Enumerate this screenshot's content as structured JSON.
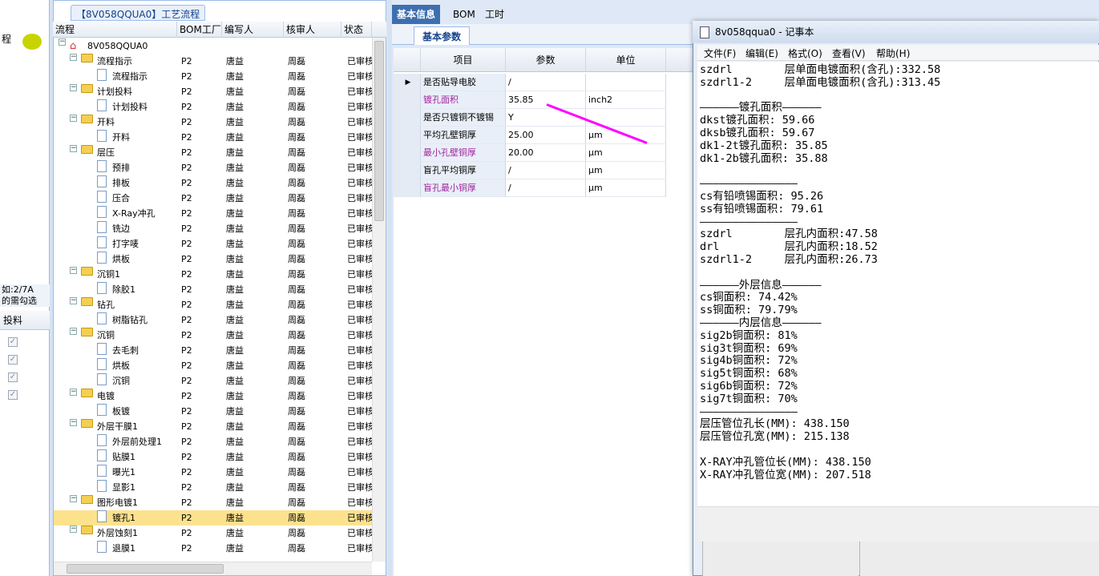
{
  "left_panel": {
    "header_fragment": "程",
    "note_line1": "如:2/7A",
    "note_line2": "的需勾选",
    "column_label": "投料",
    "checks": [
      "✓",
      "✓",
      "✓",
      "✓"
    ]
  },
  "tree": {
    "title": "【8V058QQUA0】工艺流程",
    "columns": [
      "流程",
      "BOM工厂",
      "编写人",
      "核审人",
      "状态"
    ],
    "root": "8V058QQUA0",
    "rows": [
      {
        "label": "流程指示",
        "level": 1,
        "folder": true,
        "bom": "P2",
        "writer": "唐益",
        "reviewer": "周磊",
        "status": "已审核"
      },
      {
        "label": "流程指示",
        "level": 2,
        "folder": false,
        "bom": "P2",
        "writer": "唐益",
        "reviewer": "周磊",
        "status": "已审核"
      },
      {
        "label": "计划投料",
        "level": 1,
        "folder": true,
        "bom": "P2",
        "writer": "唐益",
        "reviewer": "周磊",
        "status": "已审核"
      },
      {
        "label": "计划投料",
        "level": 2,
        "folder": false,
        "bom": "P2",
        "writer": "唐益",
        "reviewer": "周磊",
        "status": "已审核"
      },
      {
        "label": "开料",
        "level": 1,
        "folder": true,
        "bom": "P2",
        "writer": "唐益",
        "reviewer": "周磊",
        "status": "已审核"
      },
      {
        "label": "开料",
        "level": 2,
        "folder": false,
        "bom": "P2",
        "writer": "唐益",
        "reviewer": "周磊",
        "status": "已审核"
      },
      {
        "label": "层压",
        "level": 1,
        "folder": true,
        "bom": "P2",
        "writer": "唐益",
        "reviewer": "周磊",
        "status": "已审核"
      },
      {
        "label": "预排",
        "level": 2,
        "folder": false,
        "bom": "P2",
        "writer": "唐益",
        "reviewer": "周磊",
        "status": "已审核"
      },
      {
        "label": "排板",
        "level": 2,
        "folder": false,
        "bom": "P2",
        "writer": "唐益",
        "reviewer": "周磊",
        "status": "已审核"
      },
      {
        "label": "压合",
        "level": 2,
        "folder": false,
        "bom": "P2",
        "writer": "唐益",
        "reviewer": "周磊",
        "status": "已审核"
      },
      {
        "label": "X-Ray冲孔",
        "level": 2,
        "folder": false,
        "bom": "P2",
        "writer": "唐益",
        "reviewer": "周磊",
        "status": "已审核"
      },
      {
        "label": "铣边",
        "level": 2,
        "folder": false,
        "bom": "P2",
        "writer": "唐益",
        "reviewer": "周磊",
        "status": "已审核"
      },
      {
        "label": "打字唛",
        "level": 2,
        "folder": false,
        "bom": "P2",
        "writer": "唐益",
        "reviewer": "周磊",
        "status": "已审核"
      },
      {
        "label": "烘板",
        "level": 2,
        "folder": false,
        "bom": "P2",
        "writer": "唐益",
        "reviewer": "周磊",
        "status": "已审核"
      },
      {
        "label": "沉铜1",
        "level": 1,
        "folder": true,
        "bom": "P2",
        "writer": "唐益",
        "reviewer": "周磊",
        "status": "已审核"
      },
      {
        "label": "除胶1",
        "level": 2,
        "folder": false,
        "bom": "P2",
        "writer": "唐益",
        "reviewer": "周磊",
        "status": "已审核"
      },
      {
        "label": "钻孔",
        "level": 1,
        "folder": true,
        "bom": "P2",
        "writer": "唐益",
        "reviewer": "周磊",
        "status": "已审核"
      },
      {
        "label": "树脂钻孔",
        "level": 2,
        "folder": false,
        "bom": "P2",
        "writer": "唐益",
        "reviewer": "周磊",
        "status": "已审核"
      },
      {
        "label": "沉铜",
        "level": 1,
        "folder": true,
        "bom": "P2",
        "writer": "唐益",
        "reviewer": "周磊",
        "status": "已审核"
      },
      {
        "label": "去毛刺",
        "level": 2,
        "folder": false,
        "bom": "P2",
        "writer": "唐益",
        "reviewer": "周磊",
        "status": "已审核"
      },
      {
        "label": "烘板",
        "level": 2,
        "folder": false,
        "bom": "P2",
        "writer": "唐益",
        "reviewer": "周磊",
        "status": "已审核"
      },
      {
        "label": "沉铜",
        "level": 2,
        "folder": false,
        "bom": "P2",
        "writer": "唐益",
        "reviewer": "周磊",
        "status": "已审核"
      },
      {
        "label": "电镀",
        "level": 1,
        "folder": true,
        "bom": "P2",
        "writer": "唐益",
        "reviewer": "周磊",
        "status": "已审核"
      },
      {
        "label": "板镀",
        "level": 2,
        "folder": false,
        "bom": "P2",
        "writer": "唐益",
        "reviewer": "周磊",
        "status": "已审核"
      },
      {
        "label": "外层干膜1",
        "level": 1,
        "folder": true,
        "bom": "P2",
        "writer": "唐益",
        "reviewer": "周磊",
        "status": "已审核"
      },
      {
        "label": "外层前处理1",
        "level": 2,
        "folder": false,
        "bom": "P2",
        "writer": "唐益",
        "reviewer": "周磊",
        "status": "已审核"
      },
      {
        "label": "贴膜1",
        "level": 2,
        "folder": false,
        "bom": "P2",
        "writer": "唐益",
        "reviewer": "周磊",
        "status": "已审核"
      },
      {
        "label": "曝光1",
        "level": 2,
        "folder": false,
        "bom": "P2",
        "writer": "唐益",
        "reviewer": "周磊",
        "status": "已审核"
      },
      {
        "label": "显影1",
        "level": 2,
        "folder": false,
        "bom": "P2",
        "writer": "唐益",
        "reviewer": "周磊",
        "status": "已审核"
      },
      {
        "label": "图形电镀1",
        "level": 1,
        "folder": true,
        "bom": "P2",
        "writer": "唐益",
        "reviewer": "周磊",
        "status": "已审核"
      },
      {
        "label": "镀孔1",
        "level": 2,
        "folder": false,
        "bom": "P2",
        "writer": "唐益",
        "reviewer": "周磊",
        "status": "已审核",
        "selected": true
      },
      {
        "label": "外层蚀刻1",
        "level": 1,
        "folder": true,
        "bom": "P2",
        "writer": "唐益",
        "reviewer": "周磊",
        "status": "已审核"
      },
      {
        "label": "退膜1",
        "level": 2,
        "folder": false,
        "bom": "P2",
        "writer": "唐益",
        "reviewer": "周磊",
        "status": "已审核"
      }
    ]
  },
  "detail": {
    "tabs": [
      "基本信息",
      "BOM",
      "工时"
    ],
    "subtab": "基本参数",
    "columns": [
      "项目",
      "参数",
      "单位"
    ],
    "rows": [
      {
        "item": "是否贴导电胶",
        "value": "/",
        "unit": "",
        "highlight": false,
        "current": true
      },
      {
        "item": "镀孔面积",
        "value": "35.85",
        "unit": "inch2",
        "highlight": true
      },
      {
        "item": "是否只镀铜不镀锡",
        "value": "Y",
        "unit": "",
        "highlight": false
      },
      {
        "item": "平均孔壁铜厚",
        "value": "25.00",
        "unit": "μm",
        "highlight": false
      },
      {
        "item": "最小孔壁铜厚",
        "value": "20.00",
        "unit": "μm",
        "highlight": true
      },
      {
        "item": "盲孔平均铜厚",
        "value": "/",
        "unit": "μm",
        "highlight": false
      },
      {
        "item": "盲孔最小铜厚",
        "value": "/",
        "unit": "μm",
        "highlight": true
      }
    ]
  },
  "notepad": {
    "title": "8v058qqua0 - 记事本",
    "menu": [
      "文件(F)",
      "编辑(E)",
      "格式(O)",
      "查看(V)",
      "帮助(H)"
    ],
    "lines": [
      "szdrl        层单面电镀面积(含孔):332.58",
      "szdrl1-2     层单面电镀面积(含孔):313.45",
      "",
      "——————镀孔面积——————",
      "dkst镀孔面积: 59.66",
      "dksb镀孔面积: 59.67",
      "dk1-2t镀孔面积: 35.85",
      "dk1-2b镀孔面积: 35.88",
      "",
      "———————————————",
      "cs有铅喷锡面积: 95.26",
      "ss有铅喷锡面积: 79.61",
      "———————————————",
      "szdrl        层孔内面积:47.58",
      "drl          层孔内面积:18.52",
      "szdrl1-2     层孔内面积:26.73",
      "",
      "——————外层信息——————",
      "cs铜面积: 74.42%",
      "ss铜面积: 79.79%",
      "——————内层信息——————",
      "sig2b铜面积: 81%",
      "sig3t铜面积: 69%",
      "sig4b铜面积: 72%",
      "sig5t铜面积: 68%",
      "sig6b铜面积: 72%",
      "sig7t铜面积: 70%",
      "———————————————",
      "层压管位孔长(MM): 438.150",
      "层压管位孔宽(MM): 215.138",
      "",
      "X-RAY冲孔管位长(MM): 438.150",
      "X-RAY冲孔管位宽(MM): 207.518"
    ]
  },
  "colors": {
    "annotation_arrow": "#ff00ff",
    "highlight_text": "#a0259b",
    "selected_row": "#fde28e",
    "tab_active": "#3d6fb0"
  }
}
